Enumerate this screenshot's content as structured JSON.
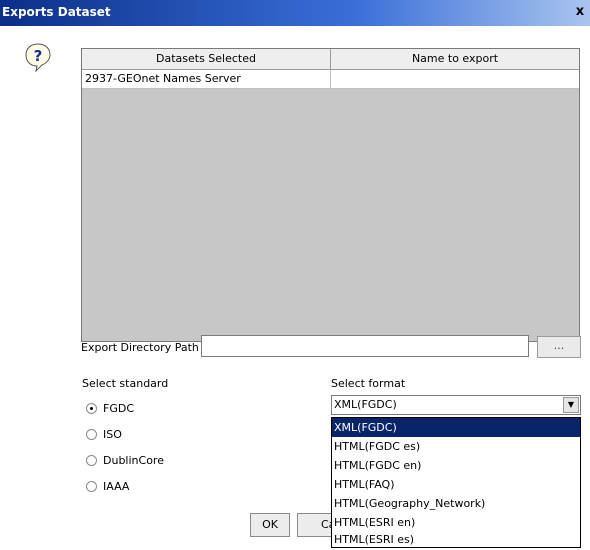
{
  "window": {
    "title": "Exports Dataset",
    "close": "x"
  },
  "table": {
    "headers": [
      "Datasets Selected",
      "Name to export"
    ],
    "rows": [
      [
        "2937-GEOnet Names Server",
        ""
      ]
    ]
  },
  "export_path": {
    "label": "Export Directory Path",
    "value": "",
    "browse_label": "..."
  },
  "standard": {
    "label": "Select standard",
    "options": [
      "FGDC",
      "ISO",
      "DublinCore",
      "IAAA"
    ],
    "selected": "FGDC"
  },
  "format": {
    "label": "Select format",
    "value": "XML(FGDC)",
    "options": [
      "XML(FGDC)",
      "HTML(FGDC es)",
      "HTML(FGDC en)",
      "HTML(FAQ)",
      "HTML(Geography_Network)",
      "HTML(ESRI en)",
      "HTML(ESRI es)"
    ],
    "highlighted": "XML(FGDC)"
  },
  "buttons": {
    "ok": "OK",
    "cancel_partial": "Ca"
  },
  "icons": {
    "question": "question-icon",
    "dropdown": "chevron-down-icon"
  }
}
